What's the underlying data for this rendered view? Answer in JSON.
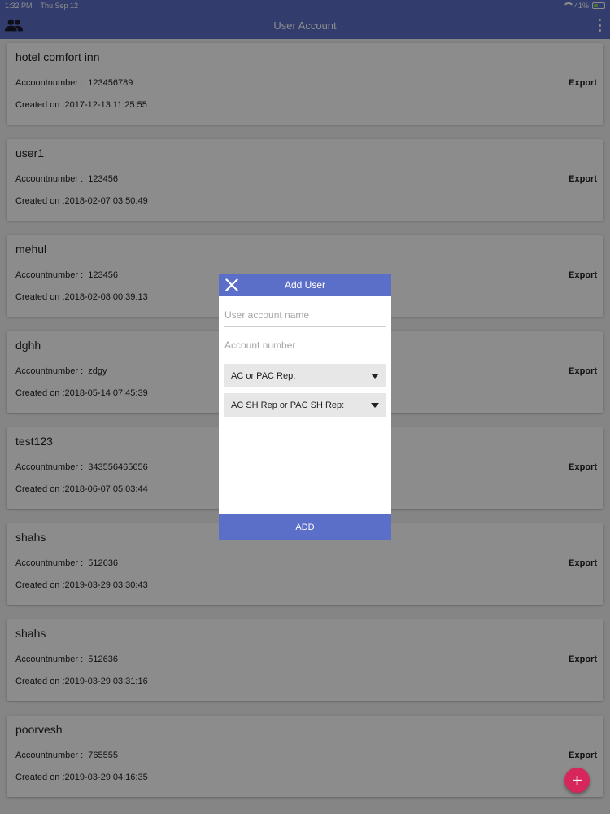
{
  "status_bar": {
    "time": "1:32 PM",
    "date": "Thu Sep 12",
    "battery": "41%",
    "battery_level": 0.41
  },
  "app_bar": {
    "title": "User Account",
    "left_icon": "people-icon",
    "right_icon": "more-vert-icon"
  },
  "accounts": [
    {
      "name": "hotel comfort inn",
      "account_label": "Accountnumber :",
      "account_number": "123456789",
      "created_label": "Created on :",
      "created": "2017-12-13 11:25:55",
      "export_label": "Export"
    },
    {
      "name": "user1",
      "account_label": "Accountnumber :",
      "account_number": "123456",
      "created_label": "Created on :",
      "created": "2018-02-07 03:50:49",
      "export_label": "Export"
    },
    {
      "name": "mehul",
      "account_label": "Accountnumber :",
      "account_number": "123456",
      "created_label": "Created on :",
      "created": "2018-02-08 00:39:13",
      "export_label": "Export"
    },
    {
      "name": "dghh",
      "account_label": "Accountnumber :",
      "account_number": "zdgy",
      "created_label": "Created on :",
      "created": "2018-05-14 07:45:39",
      "export_label": "Export"
    },
    {
      "name": "test123",
      "account_label": "Accountnumber :",
      "account_number": "343556465656",
      "created_label": "Created on :",
      "created": "2018-06-07 05:03:44",
      "export_label": "Export"
    },
    {
      "name": "shahs",
      "account_label": "Accountnumber :",
      "account_number": "512636",
      "created_label": "Created on :",
      "created": "2019-03-29 03:30:43",
      "export_label": "Export"
    },
    {
      "name": "shahs",
      "account_label": "Accountnumber :",
      "account_number": "512636",
      "created_label": "Created on :",
      "created": "2019-03-29 03:31:16",
      "export_label": "Export"
    },
    {
      "name": "poorvesh",
      "account_label": "Accountnumber :",
      "account_number": "765555",
      "created_label": "Created on :",
      "created": "2019-03-29 04:16:35",
      "export_label": "Export"
    }
  ],
  "dialog": {
    "title": "Add User",
    "close_icon": "close-icon",
    "name_placeholder": "User account name",
    "number_placeholder": "Account number",
    "select_rep": "AC or PAC Rep:",
    "select_sh_rep": "AC SH Rep or PAC SH Rep:",
    "add_label": "ADD"
  },
  "fab": {
    "icon": "plus-icon",
    "label": "+"
  },
  "colors": {
    "primary": "#5b6fc8",
    "fab": "#d6265c",
    "battery": "#7cd36a"
  }
}
